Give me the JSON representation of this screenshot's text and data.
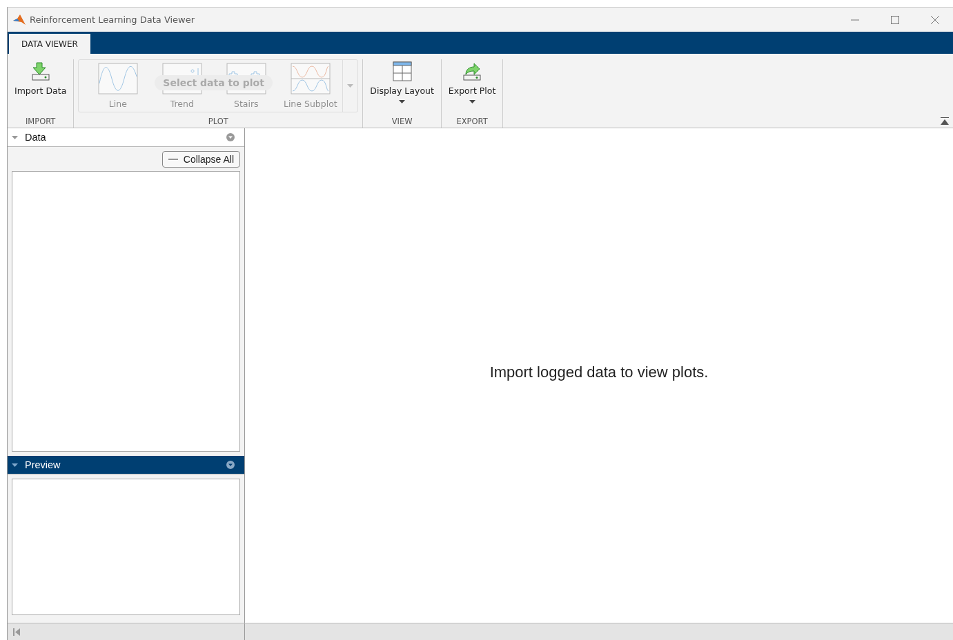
{
  "window": {
    "title": "Reinforcement Learning Data Viewer"
  },
  "tabs": [
    {
      "label": "DATA VIEWER",
      "selected": true
    }
  ],
  "ribbon": {
    "sections": [
      {
        "label": "IMPORT",
        "kind": "buttons",
        "items": [
          {
            "label": "Import Data",
            "dropdown": false
          }
        ]
      },
      {
        "label": "PLOT",
        "kind": "gallery",
        "overlay": "Select data to plot",
        "items": [
          {
            "label": "Line",
            "disabled": true
          },
          {
            "label": "Trend",
            "disabled": true
          },
          {
            "label": "Stairs",
            "disabled": true
          },
          {
            "label": "Line Subplot",
            "disabled": true
          }
        ]
      },
      {
        "label": "VIEW",
        "kind": "buttons",
        "items": [
          {
            "label": "Display Layout",
            "dropdown": true
          }
        ]
      },
      {
        "label": "EXPORT",
        "kind": "buttons",
        "items": [
          {
            "label": "Export Plot",
            "dropdown": true
          }
        ]
      }
    ]
  },
  "panels": [
    {
      "title": "Data",
      "selected": false,
      "button": "Collapse All"
    },
    {
      "title": "Preview",
      "selected": true
    }
  ],
  "message": "Import logged data to view plots."
}
